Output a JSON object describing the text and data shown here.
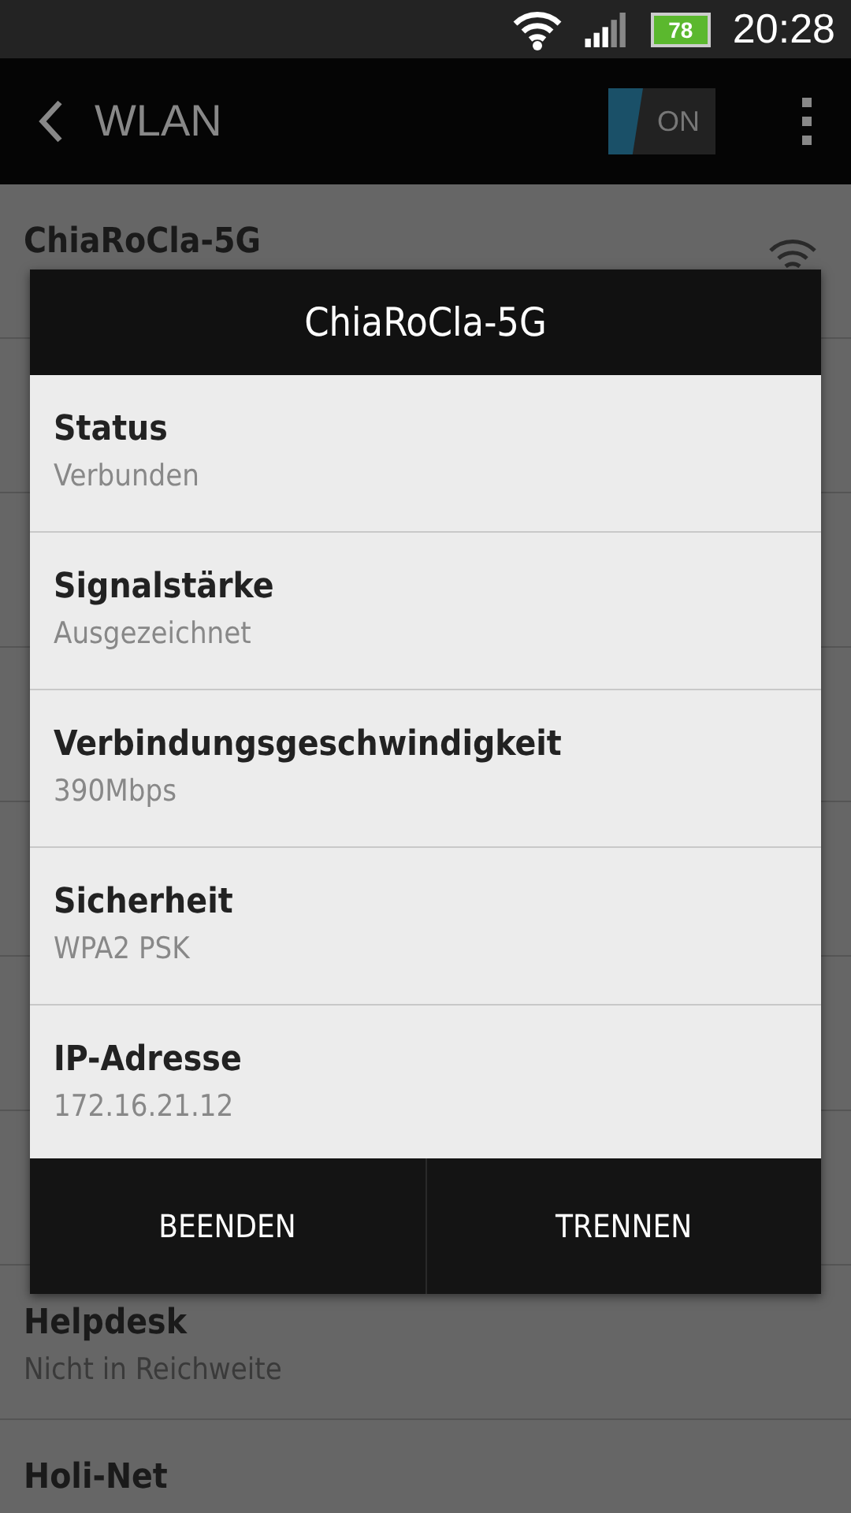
{
  "status_bar": {
    "time": "20:28",
    "battery": "78"
  },
  "app_bar": {
    "title": "WLAN",
    "toggle": {
      "label": "ON",
      "on": true
    }
  },
  "networks": [
    {
      "name": "ChiaRoCla-5G",
      "kind": "visible"
    },
    {
      "kind": "hidden"
    },
    {
      "kind": "hidden"
    },
    {
      "kind": "hidden"
    },
    {
      "kind": "hidden"
    },
    {
      "kind": "hidden"
    },
    {
      "kind": "hidden"
    },
    {
      "name": "Helpdesk",
      "status": "Nicht in Reichweite",
      "kind": "visible"
    },
    {
      "name": "Holi-Net",
      "kind": "visible"
    }
  ],
  "dialog": {
    "title": "ChiaRoCla-5G",
    "fields": [
      {
        "label": "Status",
        "value": "Verbunden"
      },
      {
        "label": "Signalstärke",
        "value": "Ausgezeichnet"
      },
      {
        "label": "Verbindungsgeschwindigkeit",
        "value": "390Mbps"
      },
      {
        "label": "Sicherheit",
        "value": "WPA2 PSK"
      },
      {
        "label": "IP-Adresse",
        "value": "172.16.21.12"
      }
    ],
    "buttons": [
      "BEENDEN",
      "TRENNEN"
    ]
  }
}
